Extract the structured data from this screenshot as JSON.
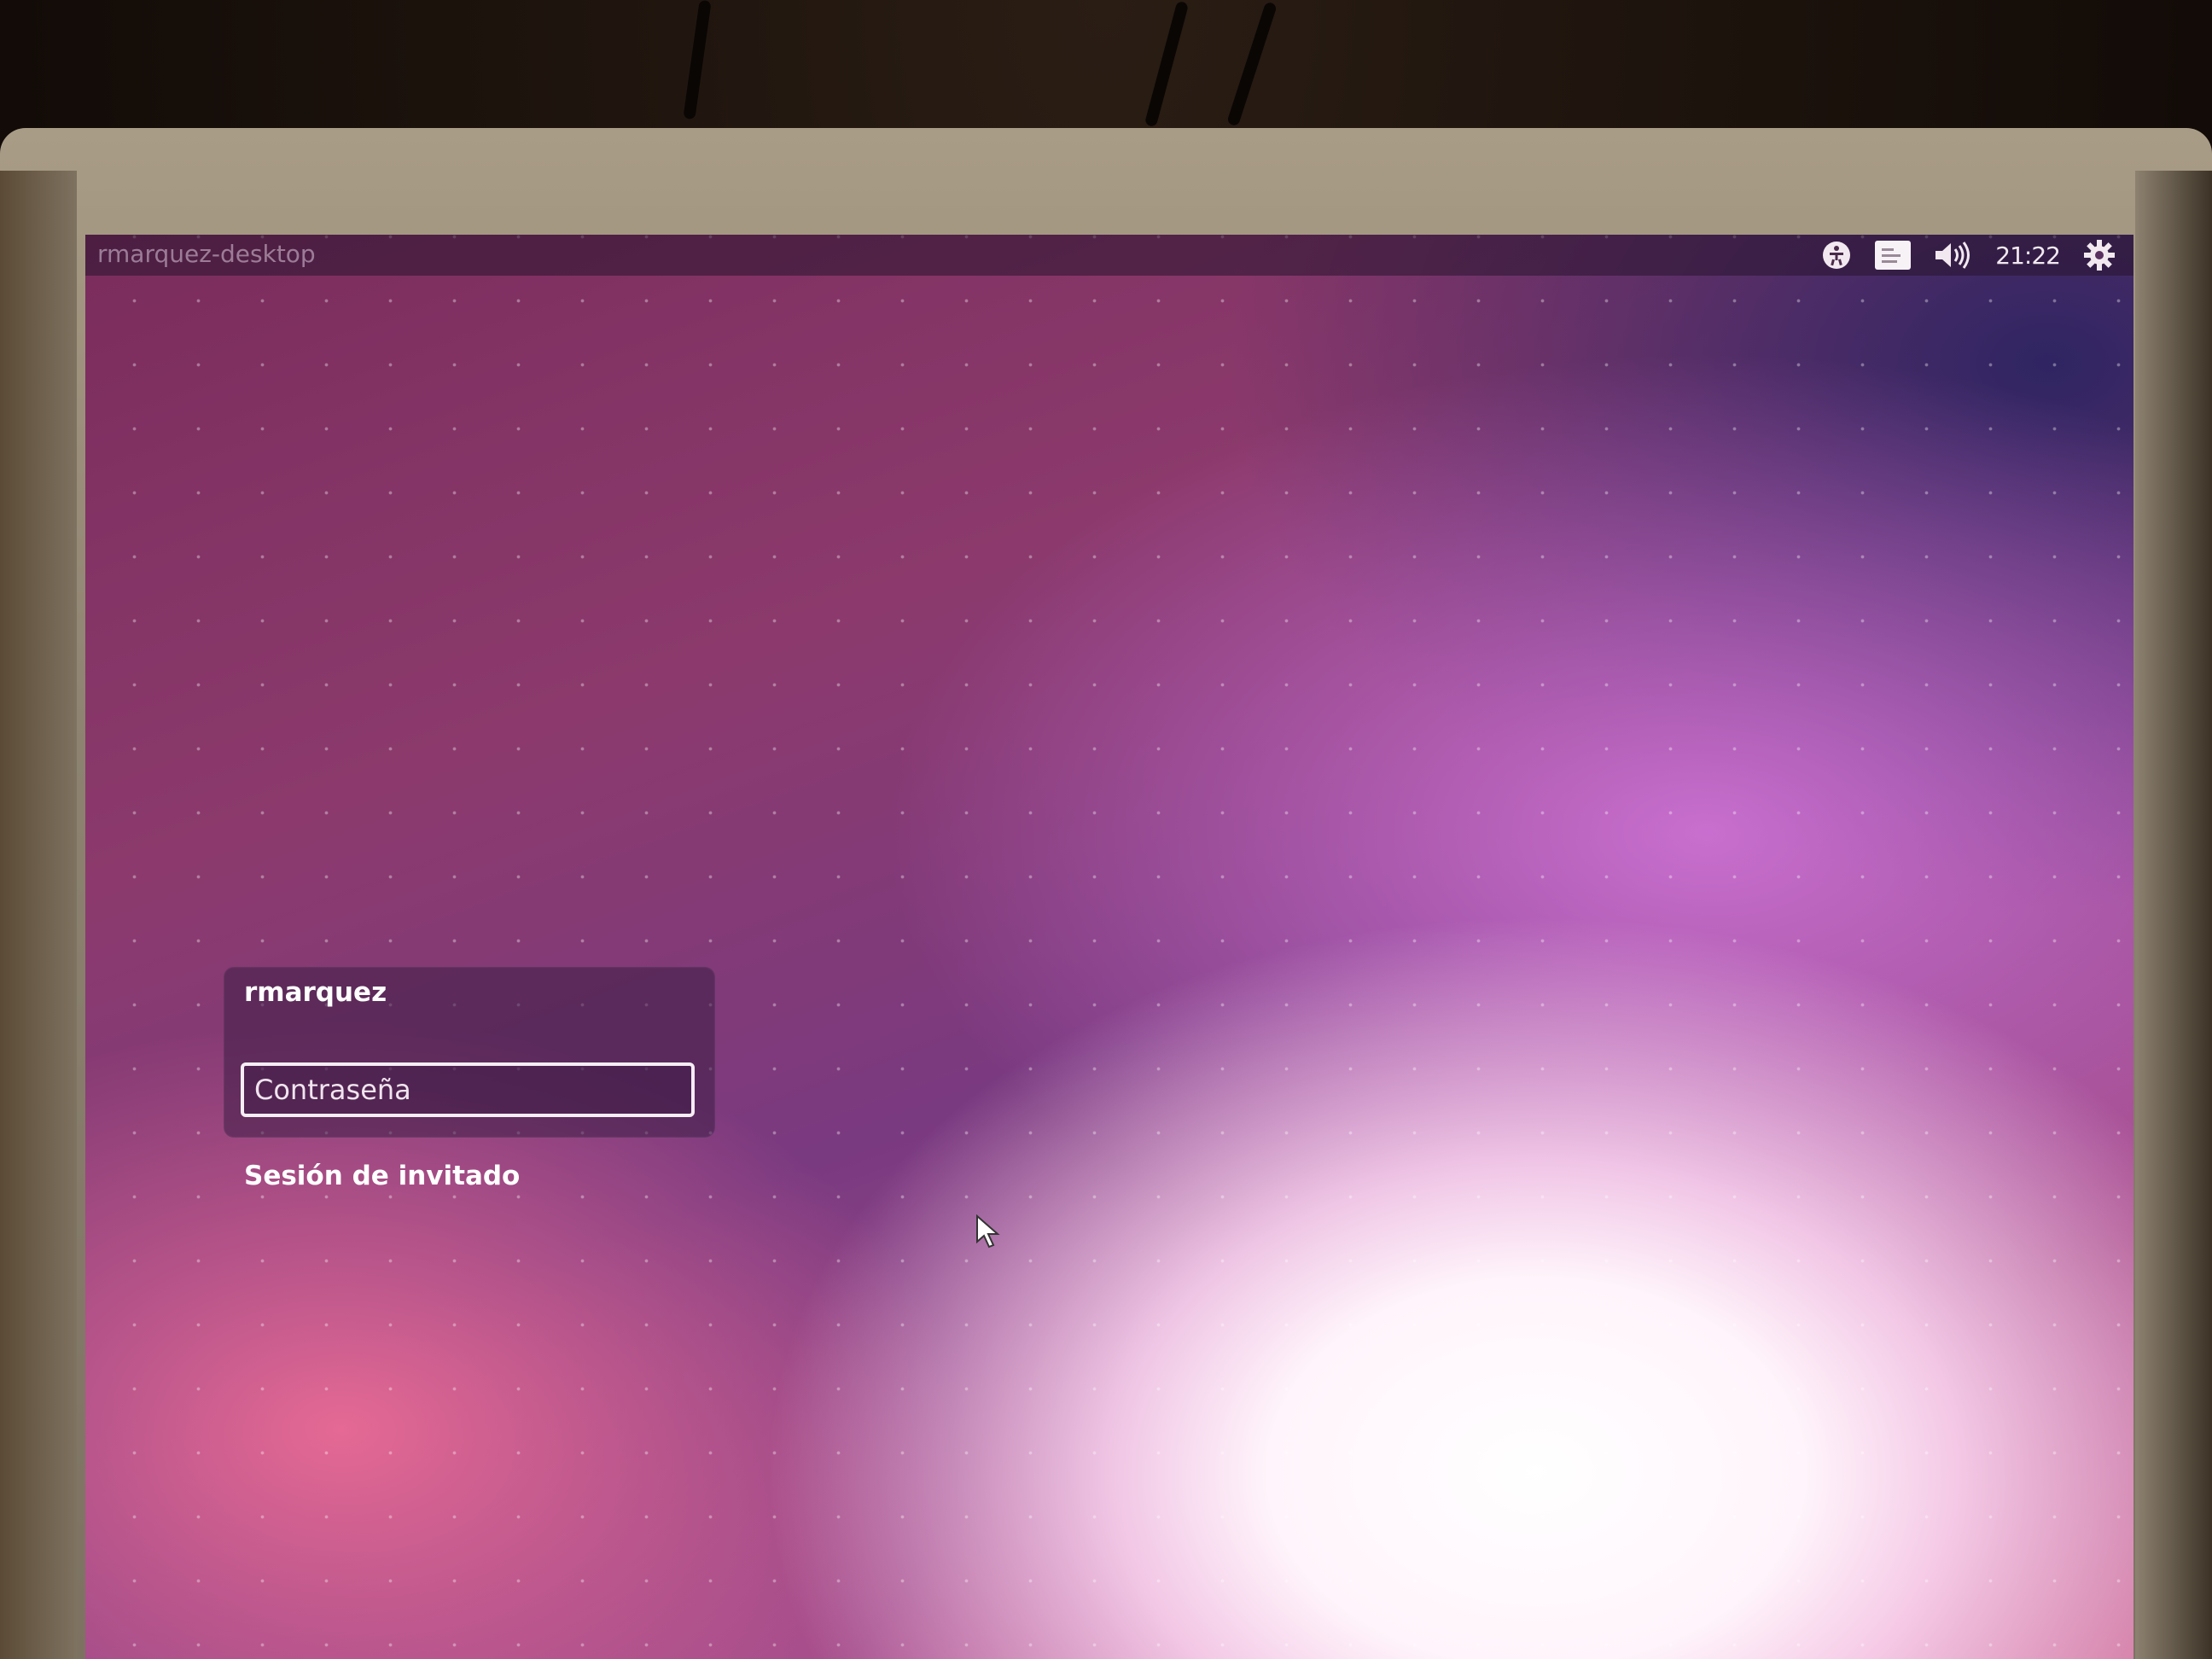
{
  "panel": {
    "hostname": "rmarquez-desktop",
    "clock": "21:22",
    "icons": [
      "accessibility-icon",
      "keyboard-layout-icon",
      "volume-icon",
      "power-gear-icon"
    ]
  },
  "login": {
    "username": "rmarquez",
    "password_placeholder": "Contraseña",
    "guest_session_label": "Sesión de invitado"
  },
  "colors": {
    "wallpaper_dark": "#7a2c5c",
    "wallpaper_light": "#ffffff",
    "panel_text": "#f2e9f0"
  }
}
